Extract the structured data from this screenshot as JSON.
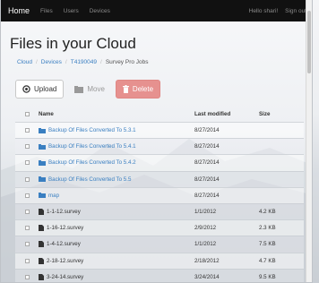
{
  "navbar": {
    "brand": "Home",
    "links": [
      "Files",
      "Users",
      "Devices"
    ],
    "greeting": "Hello shari!",
    "signout": "Sign out"
  },
  "page": {
    "title": "Files in your Cloud"
  },
  "breadcrumb": [
    "Cloud",
    "Devices",
    "T4190049",
    "Survey Pro Jobs"
  ],
  "toolbar": {
    "upload": "Upload",
    "move": "Move",
    "delete": "Delete"
  },
  "table": {
    "headers": {
      "name": "Name",
      "modified": "Last modified",
      "size": "Size"
    },
    "rows": [
      {
        "type": "folder",
        "name": "Backup Of Files Converted To 5.3.1",
        "modified": "8/27/2014",
        "size": ""
      },
      {
        "type": "folder",
        "name": "Backup Of Files Converted To 5.4.1",
        "modified": "8/27/2014",
        "size": ""
      },
      {
        "type": "folder",
        "name": "Backup Of Files Converted To 5.4.2",
        "modified": "8/27/2014",
        "size": ""
      },
      {
        "type": "folder",
        "name": "Backup Of Files Converted To 5.5",
        "modified": "8/27/2014",
        "size": ""
      },
      {
        "type": "folder",
        "name": "map",
        "modified": "8/27/2014",
        "size": ""
      },
      {
        "type": "file",
        "name": "1-1-12.survey",
        "modified": "1/1/2012",
        "size": "4.2 KB"
      },
      {
        "type": "file",
        "name": "1-16-12.survey",
        "modified": "2/9/2012",
        "size": "2.3 KB"
      },
      {
        "type": "file",
        "name": "1-4-12.survey",
        "modified": "1/1/2012",
        "size": "7.5 KB"
      },
      {
        "type": "file",
        "name": "2-18-12.survey",
        "modified": "2/18/2012",
        "size": "4.7 KB"
      },
      {
        "type": "file",
        "name": "3-24-14.survey",
        "modified": "3/24/2014",
        "size": "9.5 KB"
      }
    ]
  },
  "colors": {
    "navbar": "#111111",
    "link": "#3a7fc1",
    "delete": "#e6918f"
  }
}
